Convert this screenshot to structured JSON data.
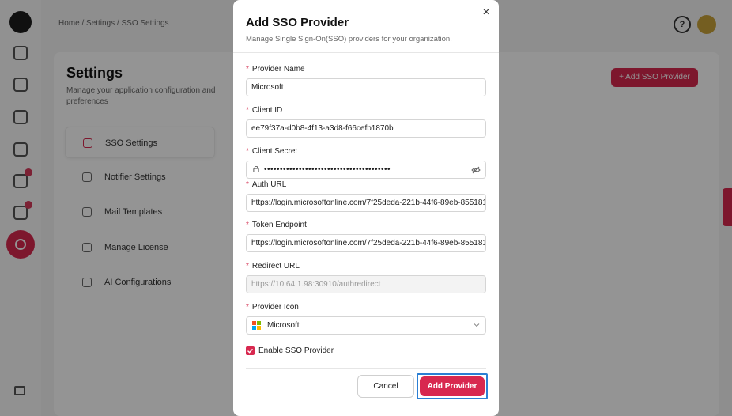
{
  "background": {
    "breadcrumb": "Home / Settings / SSO Settings",
    "page_title": "Settings",
    "page_subtitle": "Manage your application configuration and preferences",
    "add_button": "+ Add SSO Provider",
    "menu": [
      {
        "label": "SSO Settings"
      },
      {
        "label": "Notifier Settings"
      },
      {
        "label": "Mail Templates"
      },
      {
        "label": "Manage License"
      },
      {
        "label": "AI Configurations"
      }
    ],
    "help_icon": "?"
  },
  "modal": {
    "title": "Add SSO Provider",
    "description": "Manage Single Sign-On(SSO) providers for your organization.",
    "close_icon": "×",
    "required_mark": "*",
    "fields": {
      "provider_name": {
        "label": "Provider Name",
        "value": "Microsoft"
      },
      "client_id": {
        "label": "Client ID",
        "value": "ee79f37a-d0b8-4f13-a3d8-f66cefb1870b"
      },
      "client_secret": {
        "label": "Client Secret",
        "value": "••••••••••••••••••••••••••••••••••••••••"
      },
      "auth_url": {
        "label": "Auth URL",
        "value": "https://login.microsoftonline.com/7f25deda-221b-44f6-89eb-855181"
      },
      "token_endpoint": {
        "label": "Token Endpoint",
        "value": "https://login.microsoftonline.com/7f25deda-221b-44f6-89eb-855181"
      },
      "redirect_url": {
        "label": "Redirect URL",
        "value": "https://10.64.1.98:30910/authredirect"
      },
      "provider_icon": {
        "label": "Provider Icon",
        "value": "Microsoft"
      }
    },
    "enable_checkbox": {
      "label": "Enable SSO Provider",
      "checked": true
    },
    "cancel_label": "Cancel",
    "add_label": "Add Provider"
  },
  "colors": {
    "accent": "#d8284f",
    "focus_ring": "#2b7fd4",
    "ms_red": "#f25022",
    "ms_green": "#7fba00",
    "ms_blue": "#00a4ef",
    "ms_yellow": "#ffb900"
  },
  "icons": [
    "close-icon",
    "lock-icon",
    "eye-off-icon",
    "chevron-down-icon",
    "microsoft-logo",
    "check-icon"
  ]
}
